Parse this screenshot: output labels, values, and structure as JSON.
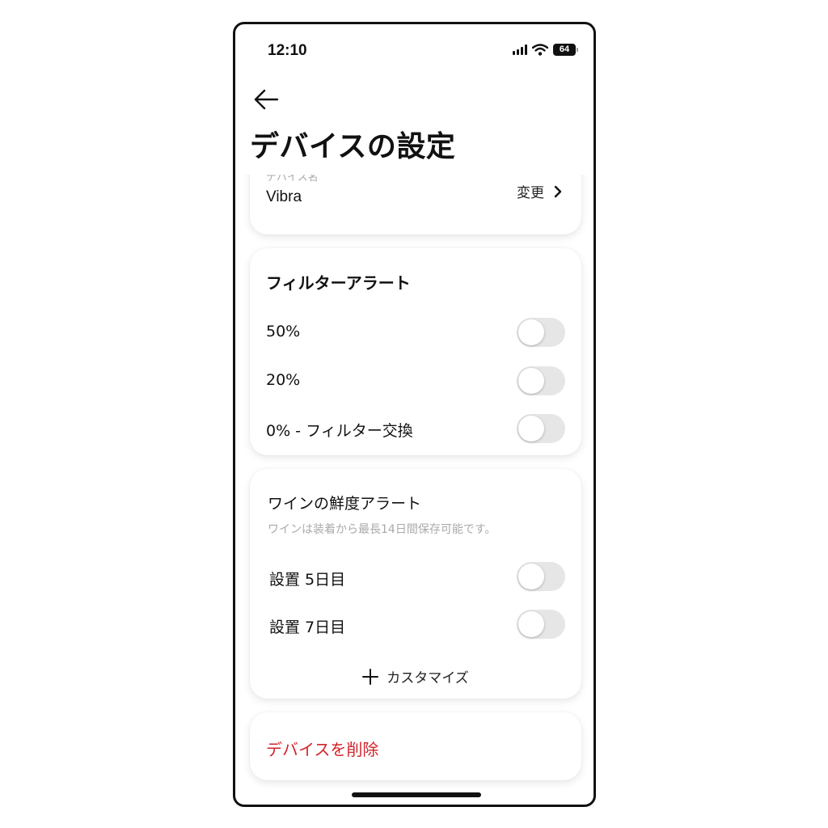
{
  "status_bar": {
    "time": "12:10",
    "battery": "64"
  },
  "header": {
    "title": "デバイスの設定"
  },
  "device_card": {
    "caption": "デバイス名",
    "name": "Vibra",
    "change_label": "変更"
  },
  "filter_card": {
    "title": "フィルターアラート",
    "rows": [
      {
        "label": "50%",
        "enabled": false
      },
      {
        "label": "20%",
        "enabled": false
      },
      {
        "label": "0% - フィルター交換",
        "enabled": false
      }
    ]
  },
  "wine_card": {
    "title": "ワインの鮮度アラート",
    "description": "ワインは装着から最長14日間保存可能です。",
    "rows": [
      {
        "label": "設置 5日目",
        "enabled": false
      },
      {
        "label": "設置 7日目",
        "enabled": false
      }
    ],
    "customize_label": "カスタマイズ"
  },
  "delete_card": {
    "label": "デバイスを削除",
    "color": "#d2232a"
  },
  "icons": [
    "back-arrow-icon",
    "chevron-right-icon",
    "plus-icon",
    "signal-icon",
    "wifi-icon",
    "battery-icon"
  ]
}
